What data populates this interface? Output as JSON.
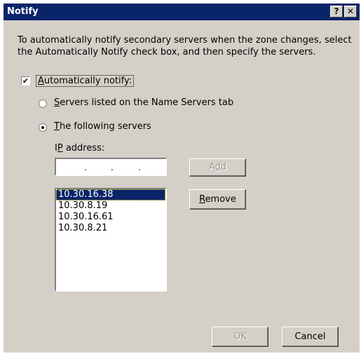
{
  "window": {
    "title": "Notify",
    "help_glyph": "?",
    "close_glyph": "✕"
  },
  "description": "To automatically notify secondary servers when the zone changes, select the Automatically Notify check box, and then specify the servers.",
  "auto_notify": {
    "checked": true,
    "check_glyph": "✔",
    "label_accel": "A",
    "label_rest": "utomatically notify:"
  },
  "options": {
    "servers_tab": {
      "selected": false,
      "accel": "S",
      "rest": "ervers listed on the Name Servers tab"
    },
    "following": {
      "selected": true,
      "accel": "T",
      "rest": "he following servers"
    }
  },
  "ip": {
    "label_pre": "I",
    "label_accel": "P",
    "label_post": " address:",
    "dot": "."
  },
  "buttons": {
    "add": {
      "pre": "A",
      "accel": "d",
      "post": "d",
      "enabled": false
    },
    "remove": {
      "pre": "",
      "accel": "R",
      "post": "emove",
      "enabled": true
    },
    "ok": {
      "label": "OK",
      "enabled": false
    },
    "cancel": {
      "label": "Cancel",
      "enabled": true
    }
  },
  "servers": [
    {
      "ip": "10.30.16.38",
      "selected": true
    },
    {
      "ip": "10.30.8.19",
      "selected": false
    },
    {
      "ip": "10.30.16.61",
      "selected": false
    },
    {
      "ip": "10.30.8.21",
      "selected": false
    }
  ]
}
